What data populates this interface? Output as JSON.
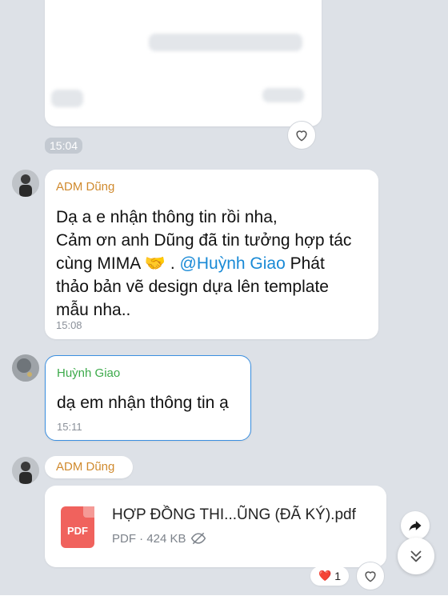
{
  "top_card": {
    "time": "15:04"
  },
  "messages": [
    {
      "sender": "ADM Dũng",
      "lines": [
        "Dạ a e nhận thông tin rồi nha,",
        "Cảm ơn anh Dũng đã tin tưởng hợp tác",
        "cùng MIMA 🤝 . ",
        "thảo bản vẽ design dựa lên template",
        "mẫu nha.."
      ],
      "mention": "@Huỳnh Giao",
      "after_mention": " Phát",
      "time": "15:08"
    },
    {
      "sender": "Huỳnh Giao",
      "text": "dạ em nhận thông tin ạ",
      "time": "15:11"
    },
    {
      "sender": "ADM Dũng",
      "file_name": "HỢP ĐỒNG THI...ŨNG (ĐÃ KÝ).pdf",
      "file_meta": "PDF · 424 KB",
      "file_icon_label": "PDF",
      "reaction_emoji": "❤️",
      "reaction_count": "1"
    }
  ],
  "colors": {
    "background": "#dde1e7",
    "adm_name": "#d08a2e",
    "giao_name": "#3caa4a",
    "mention": "#1a8ad6",
    "selected_border": "#3b8fe0",
    "pdf_icon": "#f0625d"
  },
  "icons": [
    "heart-icon",
    "share-icon",
    "chevron-double-down-icon",
    "eye-off-icon"
  ]
}
